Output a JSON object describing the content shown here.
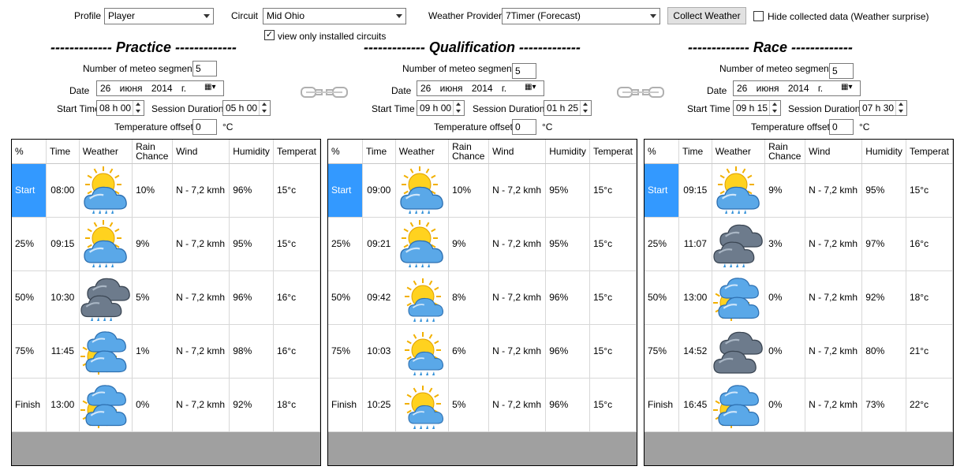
{
  "top": {
    "profile_label": "Profile",
    "profile_value": "Player",
    "circuit_label": "Circuit",
    "circuit_value": "Mid Ohio",
    "provider_label": "Weather Provider",
    "provider_value": "7Timer (Forecast)",
    "collect_button": "Collect Weather",
    "hide_label": "Hide collected data (Weather surprise)",
    "hide_checked": false,
    "installed_label": "view only installed circuits",
    "installed_checked": true
  },
  "labels": {
    "segments": "Number of meteo segments",
    "date": "Date",
    "start_time": "Start Time",
    "session_duration": "Session Duration",
    "temp_offset": "Temperature offset",
    "celsius": "°C"
  },
  "columns": [
    "%",
    "Time",
    "Weather",
    "Rain Chance",
    "Wind",
    "Humidity",
    "Temperat"
  ],
  "sessions": [
    {
      "title": "------------- Practice -------------",
      "segments": "5",
      "date": "26  июня  2014 г.",
      "start_time": "08 h 00",
      "duration": "05 h 00",
      "temp_offset": "0",
      "rows": [
        {
          "pct": "Start",
          "time": "08:00",
          "weather": "sun-cloud-rain-icon",
          "rain": "10%",
          "wind": "N - 7,2 kmh",
          "humidity": "96%",
          "temp": "15°c"
        },
        {
          "pct": "25%",
          "time": "09:15",
          "weather": "sun-cloud-rain-icon",
          "rain": "9%",
          "wind": "N - 7,2 kmh",
          "humidity": "95%",
          "temp": "15°c"
        },
        {
          "pct": "50%",
          "time": "10:30",
          "weather": "dark-clouds-rain-icon",
          "rain": "5%",
          "wind": "N - 7,2 kmh",
          "humidity": "96%",
          "temp": "16°c"
        },
        {
          "pct": "75%",
          "time": "11:45",
          "weather": "sun-clouds-icon",
          "rain": "1%",
          "wind": "N - 7,2 kmh",
          "humidity": "98%",
          "temp": "16°c"
        },
        {
          "pct": "Finish",
          "time": "13:00",
          "weather": "sun-clouds-icon",
          "rain": "0%",
          "wind": "N - 7,2 kmh",
          "humidity": "92%",
          "temp": "18°c"
        }
      ]
    },
    {
      "title": "------------- Qualification -------------",
      "segments": "5",
      "date": "26  июня  2014 г.",
      "start_time": "09 h 00",
      "duration": "01 h 25",
      "temp_offset": "0",
      "rows": [
        {
          "pct": "Start",
          "time": "09:00",
          "weather": "sun-cloud-rain-icon",
          "rain": "10%",
          "wind": "N - 7,2 kmh",
          "humidity": "95%",
          "temp": "15°c"
        },
        {
          "pct": "25%",
          "time": "09:21",
          "weather": "sun-cloud-rain-icon",
          "rain": "9%",
          "wind": "N - 7,2 kmh",
          "humidity": "95%",
          "temp": "15°c"
        },
        {
          "pct": "50%",
          "time": "09:42",
          "weather": "sun-small-cloud-rain-icon",
          "rain": "8%",
          "wind": "N - 7,2 kmh",
          "humidity": "96%",
          "temp": "15°c"
        },
        {
          "pct": "75%",
          "time": "10:03",
          "weather": "sun-small-cloud-rain-icon",
          "rain": "6%",
          "wind": "N - 7,2 kmh",
          "humidity": "96%",
          "temp": "15°c"
        },
        {
          "pct": "Finish",
          "time": "10:25",
          "weather": "sun-small-cloud-rain-icon",
          "rain": "5%",
          "wind": "N - 7,2 kmh",
          "humidity": "96%",
          "temp": "15°c"
        }
      ]
    },
    {
      "title": "------------- Race -------------",
      "segments": "5",
      "date": "26  июня  2014 г.",
      "start_time": "09 h 15",
      "duration": "07 h 30",
      "temp_offset": "0",
      "rows": [
        {
          "pct": "Start",
          "time": "09:15",
          "weather": "sun-cloud-rain-icon",
          "rain": "9%",
          "wind": "N - 7,2 kmh",
          "humidity": "95%",
          "temp": "15°c"
        },
        {
          "pct": "25%",
          "time": "11:07",
          "weather": "dark-clouds-rain-icon",
          "rain": "3%",
          "wind": "N - 7,2 kmh",
          "humidity": "97%",
          "temp": "16°c"
        },
        {
          "pct": "50%",
          "time": "13:00",
          "weather": "sun-clouds-icon",
          "rain": "0%",
          "wind": "N - 7,2 kmh",
          "humidity": "92%",
          "temp": "18°c"
        },
        {
          "pct": "75%",
          "time": "14:52",
          "weather": "dark-clouds-icon",
          "rain": "0%",
          "wind": "N - 7,2 kmh",
          "humidity": "80%",
          "temp": "21°c"
        },
        {
          "pct": "Finish",
          "time": "16:45",
          "weather": "sun-clouds-icon",
          "rain": "0%",
          "wind": "N - 7,2 kmh",
          "humidity": "73%",
          "temp": "22°c"
        }
      ]
    }
  ]
}
